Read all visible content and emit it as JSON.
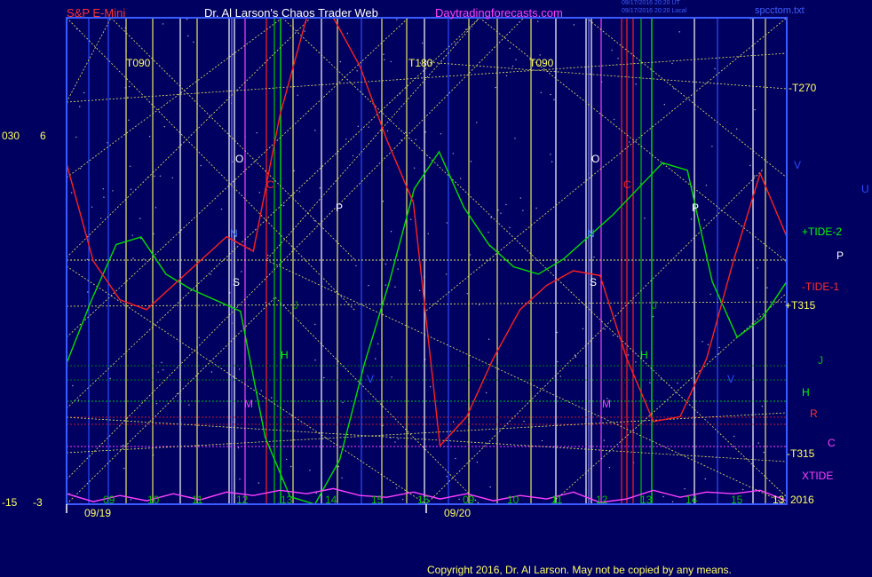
{
  "header": {
    "instrument": "S&P E-Mini",
    "site": "Dr. Al Larson's Chaos Trader Web",
    "domain_link": "Daytradingforecasts.com",
    "stamp_line1": "09/17/2016 20:20 UT",
    "stamp_line2": "09/17/2016 20:20 Local",
    "file": "spcctom.txt"
  },
  "footer": {
    "copyright": "Copyright 2016, Dr. Al Larson. May not be copied by any means."
  },
  "left_scale": {
    "top_a": "030",
    "top_b": "6",
    "bottom_a": "-15",
    "bottom_b": "-3"
  },
  "colors": {
    "background": "#000060",
    "frame": "#3a5cff",
    "green": "#00d000",
    "red": "#ff2020",
    "magenta": "#ff40ff",
    "yellow": "#e8e860",
    "white": "#ffffff",
    "blue": "#2a4cff"
  },
  "chart_data": {
    "type": "line",
    "x_labels": [
      "09",
      "10",
      "11",
      "12",
      "13",
      "14",
      "15",
      "16",
      "09",
      "10",
      "11",
      "12",
      "13",
      "14",
      "15",
      "13"
    ],
    "dates": [
      "09/19",
      "09/20"
    ],
    "year": "2016",
    "right_labels": [
      {
        "text": "-T270",
        "color": "#ffff60"
      },
      {
        "text": "+TIDE-2",
        "color": "#00ff00"
      },
      {
        "text": "P",
        "color": "#ffffff"
      },
      {
        "text": "-TIDE-1",
        "color": "#ff3030"
      },
      {
        "text": "+T315",
        "color": "#ffff60"
      },
      {
        "text": "J",
        "color": "#00c000"
      },
      {
        "text": "H",
        "color": "#00ff00"
      },
      {
        "text": "R",
        "color": "#ff3030"
      },
      {
        "text": "C",
        "color": "#ff40ff"
      },
      {
        "text": "-T315",
        "color": "#ffff60"
      },
      {
        "text": "XTIDE",
        "color": "#ff40ff"
      },
      {
        "text": "V",
        "color": "#2a4cff"
      },
      {
        "text": "U",
        "color": "#2a4cff"
      }
    ],
    "cycle_labels": [
      "T090",
      "T180",
      "T090"
    ],
    "planet_labels": [
      {
        "text": "O",
        "color": "#ffffff"
      },
      {
        "text": "C",
        "color": "#ff2020"
      },
      {
        "text": "P",
        "color": "#ffffff"
      },
      {
        "text": "N",
        "color": "#4080ff"
      },
      {
        "text": "S",
        "color": "#ffffff"
      },
      {
        "text": "J",
        "color": "#00a000"
      },
      {
        "text": "H",
        "color": "#00ff00"
      },
      {
        "text": "M",
        "color": "#ff40ff"
      },
      {
        "text": "V",
        "color": "#2a4cff"
      },
      {
        "text": "O",
        "color": "#ffffff"
      },
      {
        "text": "C",
        "color": "#ff2020"
      },
      {
        "text": "P",
        "color": "#ffffff"
      },
      {
        "text": "N",
        "color": "#4080ff"
      },
      {
        "text": "S",
        "color": "#ffffff"
      },
      {
        "text": "J",
        "color": "#00a000"
      },
      {
        "text": "H",
        "color": "#00ff00"
      },
      {
        "text": "M",
        "color": "#ff40ff"
      },
      {
        "text": "V",
        "color": "#2a4cff"
      }
    ],
    "series": [
      {
        "name": "+TIDE-2",
        "color": "#00e000",
        "values": [
          0.38,
          0.55,
          0.7,
          0.72,
          0.62,
          0.58,
          0.55,
          0.52,
          0.18,
          0.02,
          0,
          0.12,
          0.38,
          0.6,
          0.85,
          0.95,
          0.8,
          0.7,
          0.64,
          0.62,
          0.66,
          0.72,
          0.78,
          0.85,
          0.92,
          0.9,
          0.6,
          0.45,
          0.5,
          0.6
        ]
      },
      {
        "name": "-TIDE-1",
        "color": "#ff2020",
        "values": [
          0.7,
          0.5,
          0.42,
          0.4,
          0.45,
          0.5,
          0.55,
          0.52,
          0.8,
          1,
          1,
          0.9,
          0.75,
          0.62,
          0.12,
          0.18,
          0.3,
          0.4,
          0.45,
          0.48,
          0.47,
          0.3,
          0.17,
          0.18,
          0.3,
          0.5,
          0.68,
          0.55
        ]
      },
      {
        "name": "XTIDE",
        "color": "#ff40ff",
        "values": [
          0.12,
          0.03,
          0.1,
          0.04,
          0.12,
          0.05,
          0.14,
          0.1,
          0.16,
          0.12,
          0.18,
          0.1,
          0.08,
          0.14,
          0.06,
          0.12,
          0.04,
          0.1,
          0.06,
          0.14,
          0.02,
          0.06,
          0.16,
          0.08,
          0.14,
          0.12,
          0.16,
          0.04
        ]
      }
    ]
  }
}
